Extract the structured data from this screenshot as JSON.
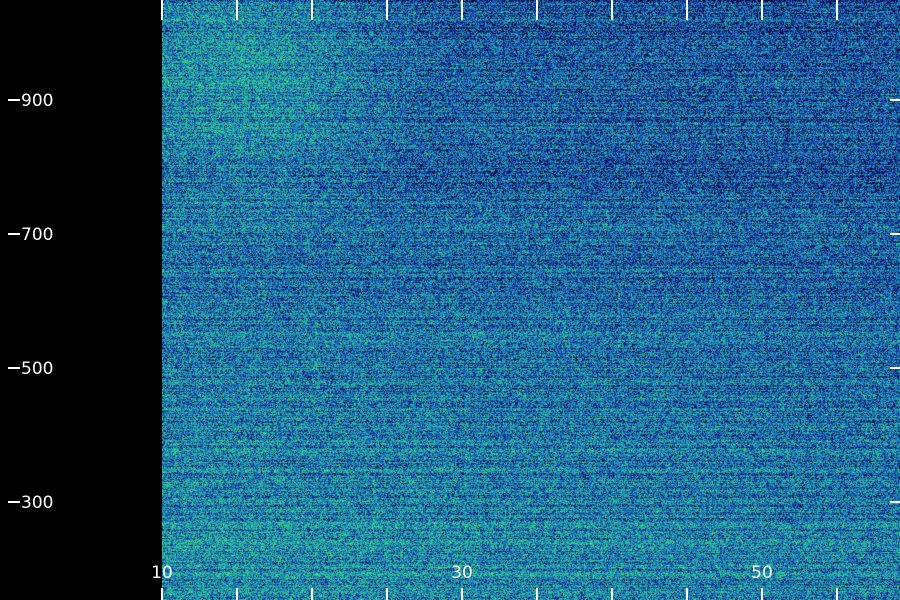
{
  "chart_data": {
    "type": "heatmap",
    "title": "",
    "xlabel": "",
    "ylabel": "",
    "xlim": [
      10,
      59
    ],
    "ylim": [
      200,
      1090
    ],
    "x_tick_labels": [
      {
        "value": 10,
        "label": "10"
      },
      {
        "value": 30,
        "label": "30"
      },
      {
        "value": 50,
        "label": "50"
      }
    ],
    "x_minor_ticks": [
      15,
      20,
      25,
      35,
      40,
      45,
      55
    ],
    "y_tick_labels": [
      {
        "value": 300,
        "label": "300"
      },
      {
        "value": 500,
        "label": "500"
      },
      {
        "value": 700,
        "label": "700"
      },
      {
        "value": 900,
        "label": "900"
      }
    ],
    "colormap": [
      "#000020",
      "#0a1a6e",
      "#1a3fb0",
      "#1f6fc0",
      "#1fa0a8",
      "#25c88a",
      "#3fe070"
    ],
    "description_of_values": "noise-like intensity field, higher toward lower rows and upper-left region",
    "grid": false,
    "legend": "none"
  }
}
